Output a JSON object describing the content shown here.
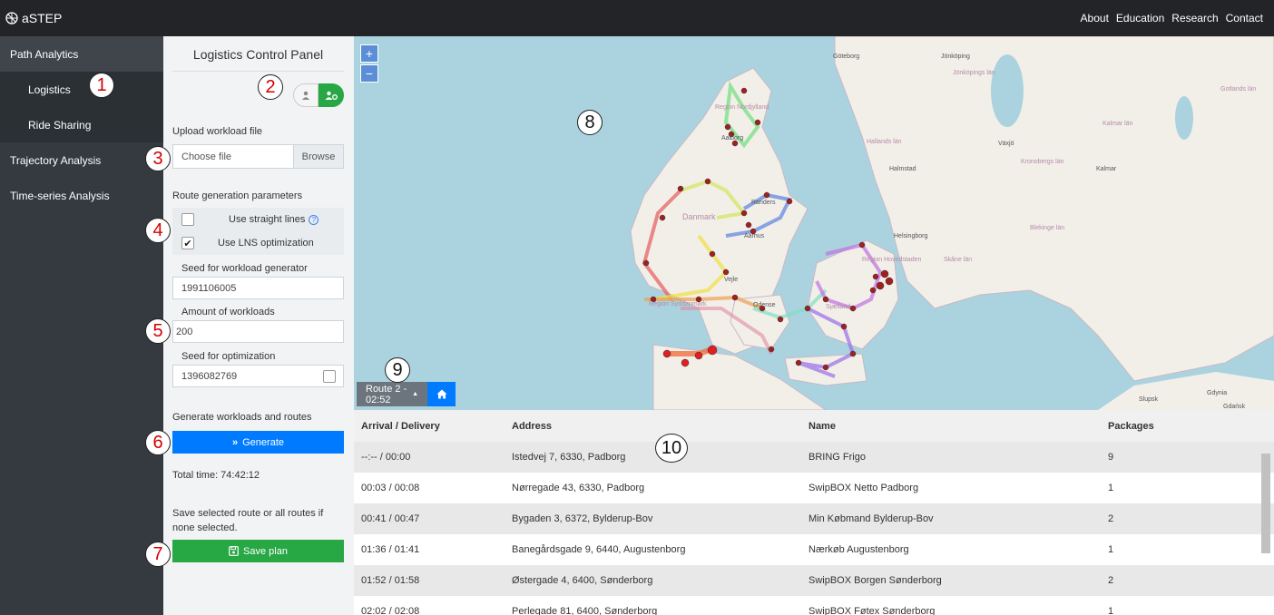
{
  "app": {
    "brand": "aSTEP"
  },
  "topnav": [
    "About",
    "Education",
    "Research",
    "Contact"
  ],
  "sidebar": {
    "items": [
      {
        "label": "Path Analytics"
      },
      {
        "label": "Logistics"
      },
      {
        "label": "Ride Sharing"
      },
      {
        "label": "Trajectory Analysis"
      },
      {
        "label": "Time-series Analysis"
      }
    ]
  },
  "panel": {
    "title": "Logistics Control Panel",
    "upload_label": "Upload workload file",
    "file_placeholder": "Choose file",
    "browse_label": "Browse",
    "params_label": "Route generation parameters",
    "straight_lines_label": "Use straight lines",
    "straight_lines_checked": false,
    "lns_label": "Use LNS optimization",
    "lns_checked": true,
    "seed_workload_label": "Seed for workload generator",
    "seed_workload_value": "1991106005",
    "amount_label": "Amount of workloads",
    "amount_value": "200",
    "seed_opt_label": "Seed for optimization",
    "seed_opt_value": "1396082769",
    "generate_section_label": "Generate workloads and routes",
    "generate_button": "Generate",
    "total_time": "Total time: 74:42:12",
    "save_hint": "Save selected route or all routes if none selected.",
    "save_button": "Save plan"
  },
  "map": {
    "zoom_in": "+",
    "zoom_out": "−",
    "route_selector": "Route 2 - 02:52",
    "place_labels": [
      "Göteborg",
      "Jönköping",
      "Jönköpings län",
      "Gotlands län",
      "Kalmar län",
      "Region Nordjylland",
      "Aalborg",
      "Hallands län",
      "Växjö",
      "Halmstad",
      "Kronobergs län",
      "Kalmar",
      "Randers",
      "Danmark",
      "Aarhus",
      "Blekinge län",
      "Helsingborg",
      "Region Hovedstaden",
      "Skåne län",
      "Vejle",
      "Region Syddanmark",
      "Odense",
      "Sjælland",
      "Slupsk",
      "Gdynia",
      "Gdańsk"
    ]
  },
  "table": {
    "headers": [
      "Arrival / Delivery",
      "Address",
      "Name",
      "Packages"
    ],
    "rows": [
      [
        "--:-- / 00:00",
        "Istedvej 7, 6330, Padborg",
        "BRING Frigo",
        "9"
      ],
      [
        "00:03 / 00:08",
        "Nørregade 43, 6330, Padborg",
        "SwipBOX Netto Padborg",
        "1"
      ],
      [
        "00:41 / 00:47",
        "Bygaden 3, 6372, Bylderup-Bov",
        "Min Købmand Bylderup-Bov",
        "2"
      ],
      [
        "01:36 / 01:41",
        "Banegårdsgade 9, 6440, Augustenborg",
        "Nærkøb Augustenborg",
        "1"
      ],
      [
        "01:52 / 01:58",
        "Østergade 4, 6400, Sønderborg",
        "SwipBOX Borgen Sønderborg",
        "2"
      ],
      [
        "02:02 / 02:08",
        "Perlegade 81, 6400, Sønderborg",
        "SwipBOX Føtex Sønderborg",
        "1"
      ]
    ]
  },
  "annotations": [
    "1",
    "2",
    "3",
    "4",
    "5",
    "6",
    "7",
    "8",
    "9",
    "10"
  ],
  "colors": {
    "navbar": "#222427",
    "sidebar": "#343a40",
    "primary": "#007bff",
    "success": "#28a745",
    "water": "#aad3df",
    "land": "#f2efe9"
  }
}
